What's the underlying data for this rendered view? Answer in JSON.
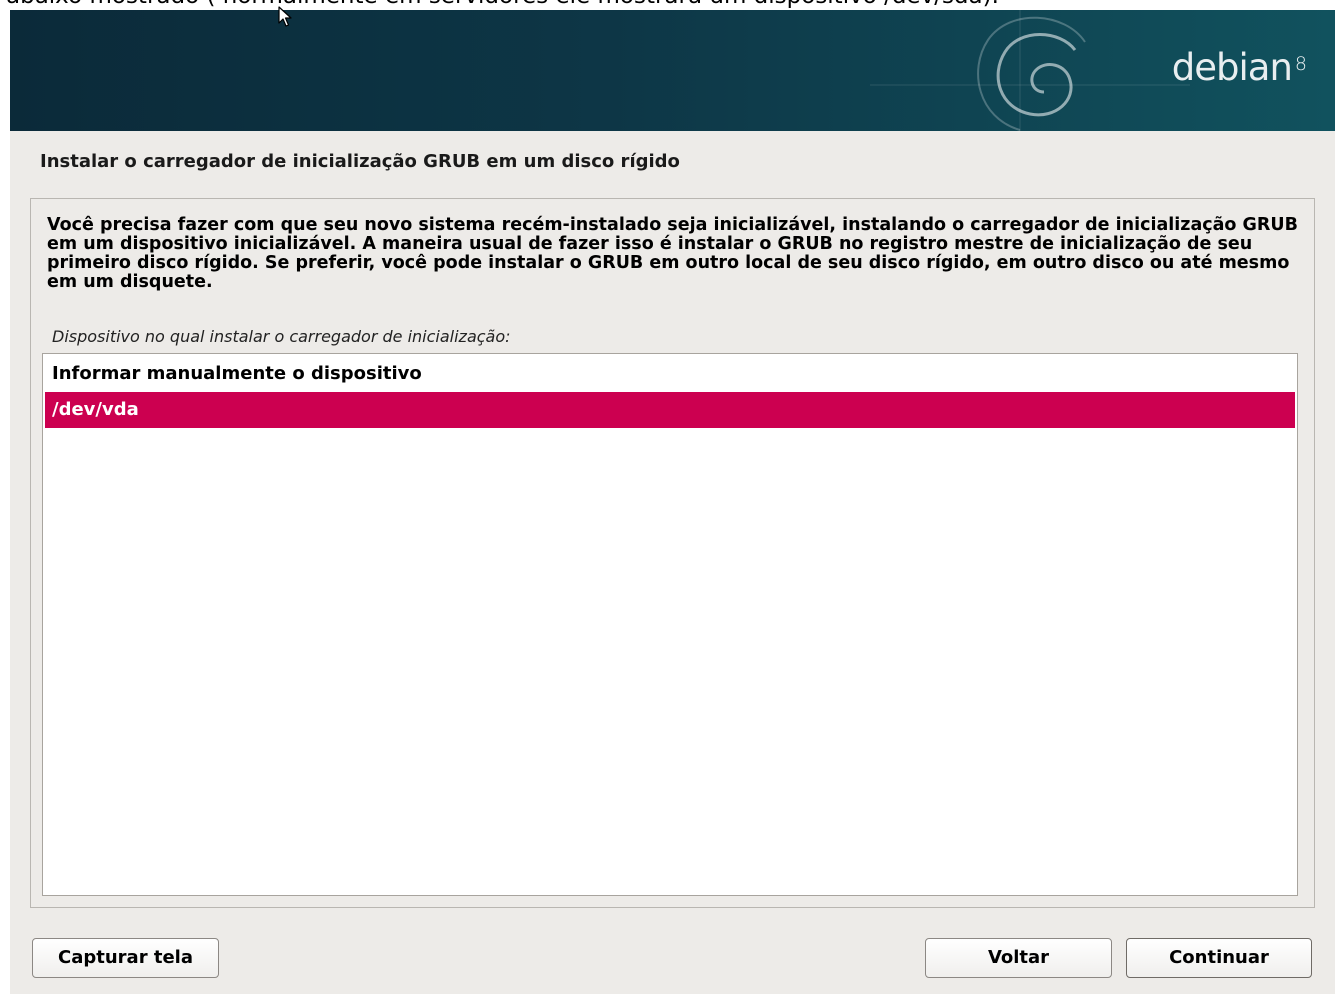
{
  "caption_text": "abaixo mostrado ( normalmente em servidores ele mostrará um dispositivo /dev/sda).",
  "banner": {
    "logo_word": "debian",
    "logo_version": "8"
  },
  "dialog": {
    "title": "Instalar o carregador de inicialização GRUB em um disco rígido",
    "description": "Você precisa fazer com que seu novo sistema recém-instalado seja inicializável, instalando o carregador de inicialização GRUB em um dispositivo inicializável. A maneira usual de fazer isso é instalar o GRUB no registro mestre de inicialização de seu primeiro disco rígido. Se preferir, você pode instalar o GRUB em outro local de seu disco rígido, em outro disco ou até mesmo em um disquete.",
    "prompt": "Dispositivo no qual instalar o carregador de inicialização:",
    "options": [
      {
        "label": "Informar manualmente o dispositivo",
        "selected": false
      },
      {
        "label": "/dev/vda",
        "selected": true
      }
    ]
  },
  "buttons": {
    "screenshot": "Capturar tela",
    "back": "Voltar",
    "continue": "Continuar"
  },
  "colors": {
    "banner_dark": "#0b2a39",
    "selection": "#cc0050",
    "background": "#edebe8"
  }
}
